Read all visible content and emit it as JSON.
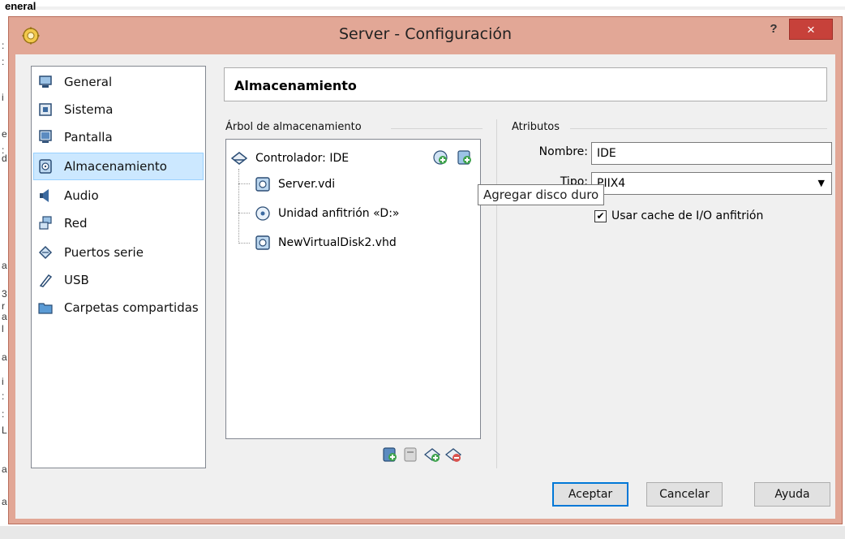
{
  "background": {
    "title_fragment": "eneral",
    "edge_glyphs": [
      ":",
      ":",
      "i",
      "e",
      ":",
      "d",
      "a",
      "3",
      "r",
      "a",
      "l",
      "a",
      "i",
      ":",
      ":",
      "L",
      "a",
      "a"
    ]
  },
  "window": {
    "title": "Server - Configuración",
    "help_label": "?",
    "close_label": "×"
  },
  "sidebar": {
    "items": [
      {
        "label": "General",
        "icon": "monitor-icon"
      },
      {
        "label": "Sistema",
        "icon": "chip-icon"
      },
      {
        "label": "Pantalla",
        "icon": "display-icon"
      },
      {
        "label": "Almacenamiento",
        "icon": "disk-icon",
        "selected": true
      },
      {
        "label": "Audio",
        "icon": "speaker-icon"
      },
      {
        "label": "Red",
        "icon": "network-icon"
      },
      {
        "label": "Puertos serie",
        "icon": "serial-port-icon"
      },
      {
        "label": "USB",
        "icon": "usb-icon"
      },
      {
        "label": "Carpetas compartidas",
        "icon": "folder-icon"
      }
    ]
  },
  "section": {
    "title": "Almacenamiento"
  },
  "storage_tree": {
    "group_label": "Árbol de almacenamiento",
    "controller": "Controlador: IDE",
    "items": [
      {
        "label": "Server.vdi",
        "icon": "hard-disk-icon"
      },
      {
        "label": "Unidad anfitrión «D:»",
        "icon": "optical-disc-icon"
      },
      {
        "label": "NewVirtualDisk2.vhd",
        "icon": "hard-disk-icon"
      }
    ],
    "tooltip": "Agregar disco duro"
  },
  "attributes": {
    "group_label": "Atributos",
    "name_label": "Nombre:",
    "name_value": "IDE",
    "type_label": "Tipo:",
    "type_value": "PIIX4",
    "cache_label": "Usar cache de I/O anfitrión",
    "cache_checked": true
  },
  "buttons": {
    "accept": "Aceptar",
    "cancel": "Cancelar",
    "help": "Ayuda"
  },
  "colors": {
    "window_frame": "#e2a796",
    "close_button": "#c7413a",
    "selected_bg": "#cce8ff",
    "accent": "#0078d7"
  }
}
